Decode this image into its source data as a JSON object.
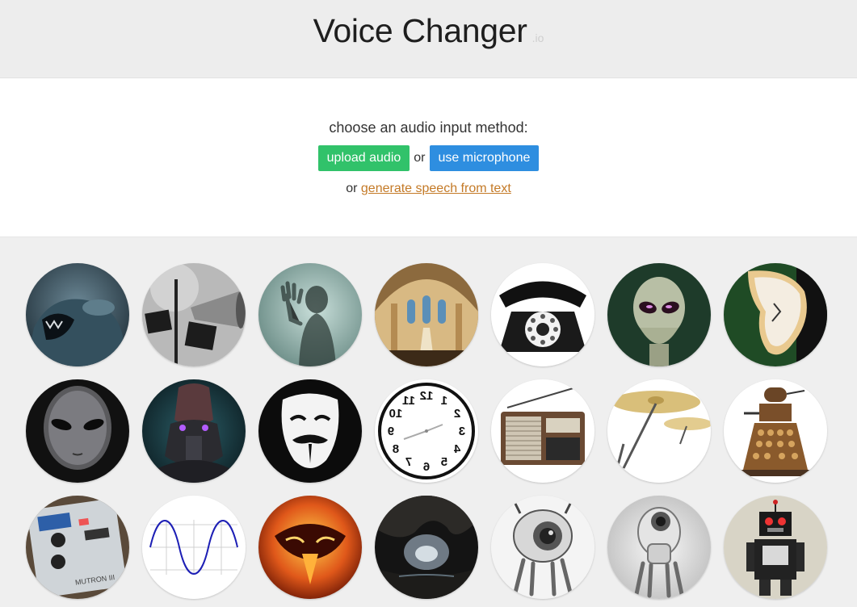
{
  "header": {
    "title": "Voice Changer",
    "suffix": ".io"
  },
  "hero": {
    "prompt": "choose an audio input method:",
    "upload_label": "upload audio",
    "or_label": "or",
    "mic_label": "use microphone",
    "tts_prefix": "or",
    "tts_link": "generate speech from text"
  },
  "voices": [
    {
      "name": "monster-voice-icon"
    },
    {
      "name": "megaphone-voice-icon"
    },
    {
      "name": "ghost-voice-icon"
    },
    {
      "name": "cathedral-voice-icon"
    },
    {
      "name": "telephone-voice-icon"
    },
    {
      "name": "alien-voice-icon"
    },
    {
      "name": "melting-clock-voice-icon"
    },
    {
      "name": "grey-alien-voice-icon"
    },
    {
      "name": "cyborg-voice-icon"
    },
    {
      "name": "anonymous-mask-voice-icon"
    },
    {
      "name": "reversed-clock-voice-icon"
    },
    {
      "name": "radio-voice-icon"
    },
    {
      "name": "cymbal-voice-icon"
    },
    {
      "name": "dalek-voice-icon"
    },
    {
      "name": "guitar-pedal-voice-icon"
    },
    {
      "name": "sine-wave-voice-icon"
    },
    {
      "name": "fire-demon-voice-icon"
    },
    {
      "name": "cave-voice-icon"
    },
    {
      "name": "robot-eye-voice-icon"
    },
    {
      "name": "white-robot-voice-icon"
    },
    {
      "name": "toy-robot-voice-icon"
    }
  ],
  "reversed_clock_numbers": [
    "12",
    "11",
    "10",
    "9",
    "8",
    "7",
    "6",
    "5",
    "4",
    "3",
    "2",
    "1"
  ],
  "pedal_label": "MUTRON III"
}
